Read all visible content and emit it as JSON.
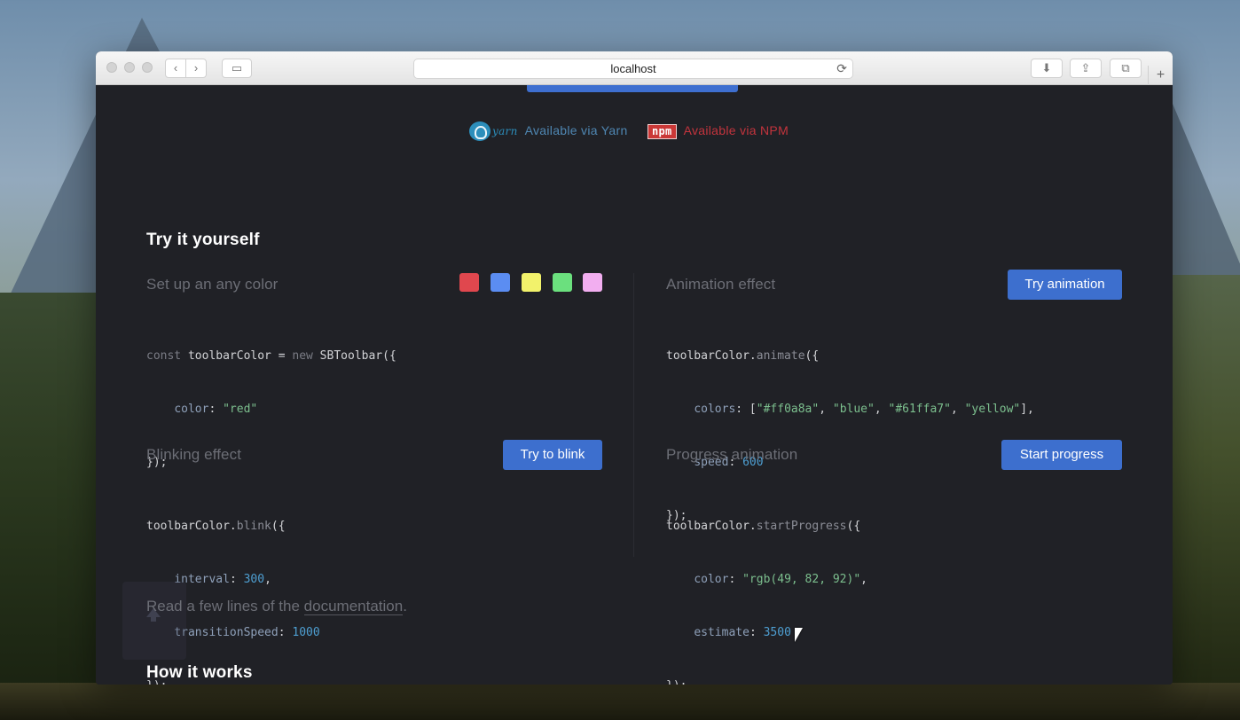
{
  "browser": {
    "address": "localhost",
    "reload_icon": "⟳",
    "back_icon": "‹",
    "forward_icon": "›",
    "sidebar_icon": "▭",
    "download_icon": "⬇",
    "share_icon": "⇪",
    "tabs_icon": "⧉",
    "new_tab_icon": "+"
  },
  "packages": {
    "yarn_word": "yarn",
    "yarn_label": "Available via Yarn",
    "npm_word": "npm",
    "npm_label": "Available via NPM"
  },
  "try_section": {
    "title": "Try it yourself",
    "color": {
      "title": "Set up an any color",
      "swatches": [
        "#e0474e",
        "#5b8df2",
        "#f2f26b",
        "#6be07e",
        "#f2aef0"
      ],
      "code": [
        "const toolbarColor = new SBToolbar({",
        "    color: \"red\"",
        "});"
      ]
    },
    "animation": {
      "title": "Animation effect",
      "button": "Try animation",
      "code": [
        "toolbarColor.animate({",
        "    colors: [\"#ff0a8a\", \"blue\", \"#61ffa7\", \"yellow\"],",
        "    speed: 600",
        "});"
      ]
    },
    "blink": {
      "title": "Blinking effect",
      "button": "Try to blink",
      "code": [
        "toolbarColor.blink({",
        "    interval: 300,",
        "    transitionSpeed: 1000",
        "});"
      ]
    },
    "progress": {
      "title": "Progress animation",
      "button": "Start progress",
      "code": [
        "toolbarColor.startProgress({",
        "    color: \"rgb(49, 82, 92)\",",
        "    estimate: 3500",
        "});"
      ]
    }
  },
  "docs": {
    "prefix": "Read a few lines of the ",
    "link": "documentation",
    "suffix": "."
  },
  "how": {
    "title": "How it works"
  }
}
